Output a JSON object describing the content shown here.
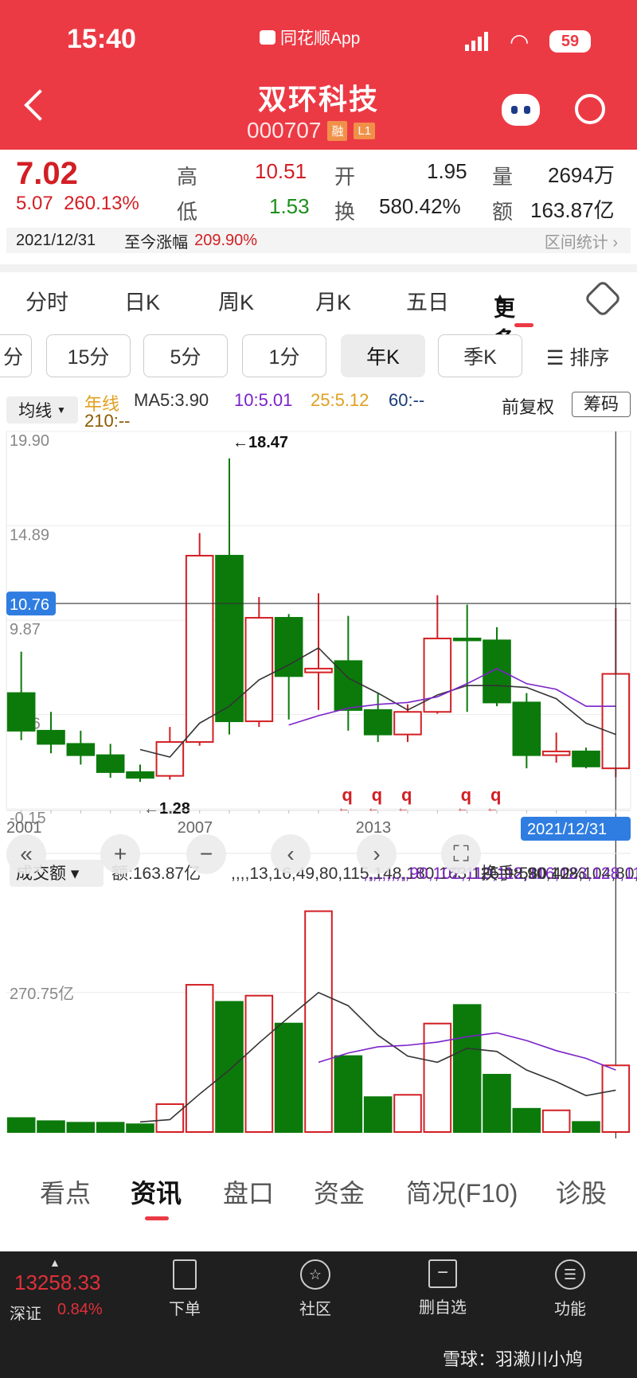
{
  "status_bar": {
    "time": "15:40",
    "app": "同花顺App",
    "battery": "59"
  },
  "header": {
    "title": "双环科技",
    "code": "000707",
    "tag1": "融",
    "tag2": "L1"
  },
  "quote": {
    "price": "7.02",
    "change": "5.07",
    "change_pct": "260.13%",
    "high_label": "高",
    "high": "10.51",
    "low_label": "低",
    "low": "1.53",
    "open_label": "开",
    "open": "1.95",
    "turnover_label": "换",
    "turnover": "580.42%",
    "vol_label": "量",
    "vol": "2694万",
    "amt_label": "额",
    "amt": "163.87亿",
    "date": "2021/12/31",
    "since_label": "至今涨幅",
    "since_value": "209.90%",
    "range_stat": "区间统计"
  },
  "period_tabs": [
    "分时",
    "日K",
    "周K",
    "月K",
    "五日",
    "更多"
  ],
  "interval_buttons": [
    "分",
    "15分",
    "5分",
    "1分",
    "年K",
    "季K"
  ],
  "sort_label": "排序",
  "ma": {
    "selector": "均线",
    "label": "年线",
    "ma5": "MA5:3.90",
    "ma10": "10:5.01",
    "ma25": "25:5.12",
    "ma60": "60:--",
    "ma210": "210:--",
    "adjust": "前复权",
    "chip": "筹码"
  },
  "colors": {
    "red": "#d21f24",
    "green": "#0b7a0b",
    "purple": "#7b22c8",
    "orange": "#e0a020",
    "header": "#ec3a45"
  },
  "chart_data": {
    "type": "candlestick",
    "y_ticks": [
      "19.90",
      "14.89",
      "9.87",
      "4.86",
      "-0.15"
    ],
    "x_ticks": [
      "2001",
      "2007",
      "2013"
    ],
    "crosshair_value": "10.76",
    "crosshair_date": "2021/12/31",
    "max_label": "←18.47",
    "min_label": "←1.28",
    "candles": [
      {
        "o": 6.0,
        "c": 4.0,
        "h": 8.2,
        "l": 3.5
      },
      {
        "o": 4.0,
        "c": 3.3,
        "h": 5.0,
        "l": 2.8
      },
      {
        "o": 3.3,
        "c": 2.7,
        "h": 4.0,
        "l": 2.2
      },
      {
        "o": 2.7,
        "c": 1.8,
        "h": 3.3,
        "l": 1.5
      },
      {
        "o": 1.8,
        "c": 1.5,
        "h": 2.2,
        "l": 1.28
      },
      {
        "o": 1.6,
        "c": 3.4,
        "h": 4.2,
        "l": 1.4
      },
      {
        "o": 3.4,
        "c": 13.3,
        "h": 14.5,
        "l": 3.2
      },
      {
        "o": 13.3,
        "c": 4.5,
        "h": 18.47,
        "l": 3.8
      },
      {
        "o": 4.5,
        "c": 10.0,
        "h": 11.1,
        "l": 4.2
      },
      {
        "o": 10.0,
        "c": 6.9,
        "h": 10.2,
        "l": 4.6
      },
      {
        "o": 7.1,
        "c": 7.3,
        "h": 11.3,
        "l": 5.1
      },
      {
        "o": 7.7,
        "c": 5.1,
        "h": 10.1,
        "l": 4.0
      },
      {
        "o": 5.1,
        "c": 3.8,
        "h": 6.0,
        "l": 3.4
      },
      {
        "o": 3.8,
        "c": 5.0,
        "h": 5.4,
        "l": 3.4
      },
      {
        "o": 5.0,
        "c": 8.9,
        "h": 11.2,
        "l": 4.9
      },
      {
        "o": 8.9,
        "c": 8.8,
        "h": 10.7,
        "l": 5.0
      },
      {
        "o": 8.8,
        "c": 5.5,
        "h": 9.5,
        "l": 5.3
      },
      {
        "o": 5.5,
        "c": 2.7,
        "h": 6.0,
        "l": 2.0
      },
      {
        "o": 2.7,
        "c": 2.9,
        "h": 3.9,
        "l": 2.3
      },
      {
        "o": 2.9,
        "c": 2.1,
        "h": 3.1,
        "l": 2.0
      },
      {
        "o": 2.0,
        "c": 7.02,
        "h": 10.51,
        "l": 1.53
      }
    ],
    "ma5_line": [
      null,
      null,
      null,
      null,
      3.0,
      2.6,
      4.4,
      5.3,
      6.7,
      7.5,
      8.4,
      6.8,
      6.0,
      5.1,
      5.9,
      6.4,
      6.4,
      6.3,
      5.7,
      4.4,
      3.8
    ],
    "ma10_line": [
      null,
      null,
      null,
      null,
      null,
      null,
      null,
      null,
      null,
      4.3,
      4.8,
      5.2,
      5.4,
      5.5,
      5.8,
      6.5,
      7.3,
      6.5,
      6.2,
      5.3,
      5.3
    ],
    "vol_title": "成交额",
    "vol_amt": "额:163.87亿",
    "vol_ma5": [
      null,
      null,
      null,
      null,
      13,
      16,
      49,
      80,
      115,
      148,
      180,
      163,
      125,
      98,
      90,
      108,
      104,
      80,
      65,
      47,
      54
    ],
    "vol_ma10": [
      null,
      null,
      null,
      null,
      null,
      null,
      null,
      null,
      null,
      null,
      90,
      102,
      110,
      112,
      116,
      123,
      128,
      118,
      105,
      95,
      80
    ],
    "vol_turnover": "换手:580.42%",
    "vol_tick": "270.75亿",
    "volumes": [
      18,
      14,
      12,
      12,
      10,
      36,
      190,
      168,
      176,
      140,
      285,
      98,
      45,
      48,
      140,
      164,
      74,
      30,
      28,
      13,
      86
    ],
    "q_markers": [
      11,
      12,
      13,
      15,
      16
    ]
  },
  "bottom_tabs": [
    "看点",
    "资讯",
    "盘口",
    "资金",
    "简况(F10)",
    "诊股"
  ],
  "bottom_bar": {
    "index_value": "13258.33",
    "index_name": "深证",
    "index_pct": "0.84%",
    "items": [
      "下单",
      "社区",
      "删自选",
      "功能"
    ]
  },
  "watermark": "雪球：羽濑川小鸠"
}
